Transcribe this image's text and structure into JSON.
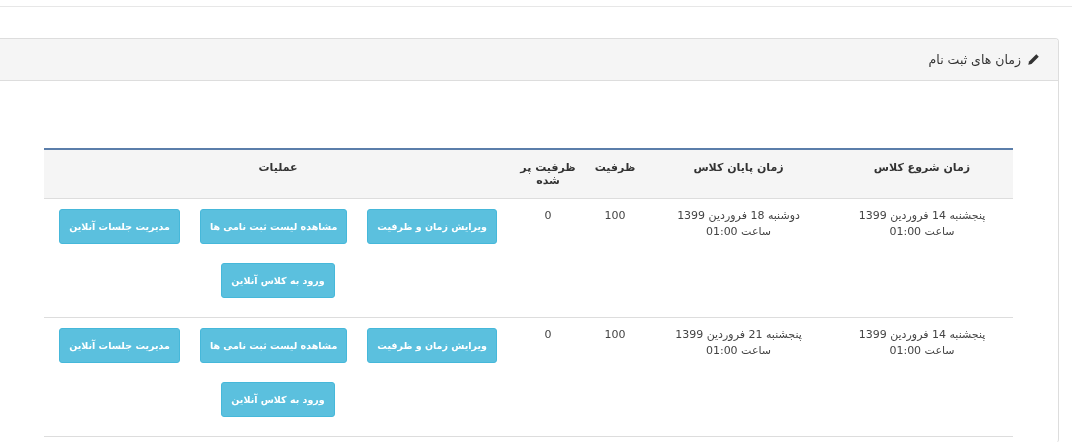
{
  "panel": {
    "title": "زمان های ثبت نام"
  },
  "table": {
    "columns": [
      "زمان شروع کلاس",
      "زمان پایان کلاس",
      "ظرفیت",
      "ظرفیت پر شده",
      "عملیات"
    ],
    "rows": [
      {
        "start": {
          "date": "پنجشنبه 14 فروردین 1399",
          "time": "ساعت 01:00"
        },
        "end": {
          "date": "دوشنبه 18 فروردین 1399",
          "time": "ساعت 01:00"
        },
        "capacity": "100",
        "filled": "0",
        "actions": [
          "ویرایش زمان و ظرفیت",
          "مشاهده لیست ثبت نامی ها",
          "مدیریت جلسات آنلاین",
          "ورود به کلاس آنلاین"
        ]
      },
      {
        "start": {
          "date": "پنجشنبه 14 فروردین 1399",
          "time": "ساعت 01:00"
        },
        "end": {
          "date": "پنجشنبه 21 فروردین 1399",
          "time": "ساعت 01:00"
        },
        "capacity": "100",
        "filled": "0",
        "actions": [
          "ویرایش زمان و ظرفیت",
          "مشاهده لیست ثبت نامی ها",
          "مدیریت جلسات آنلاین",
          "ورود به کلاس آنلاین"
        ]
      }
    ]
  }
}
